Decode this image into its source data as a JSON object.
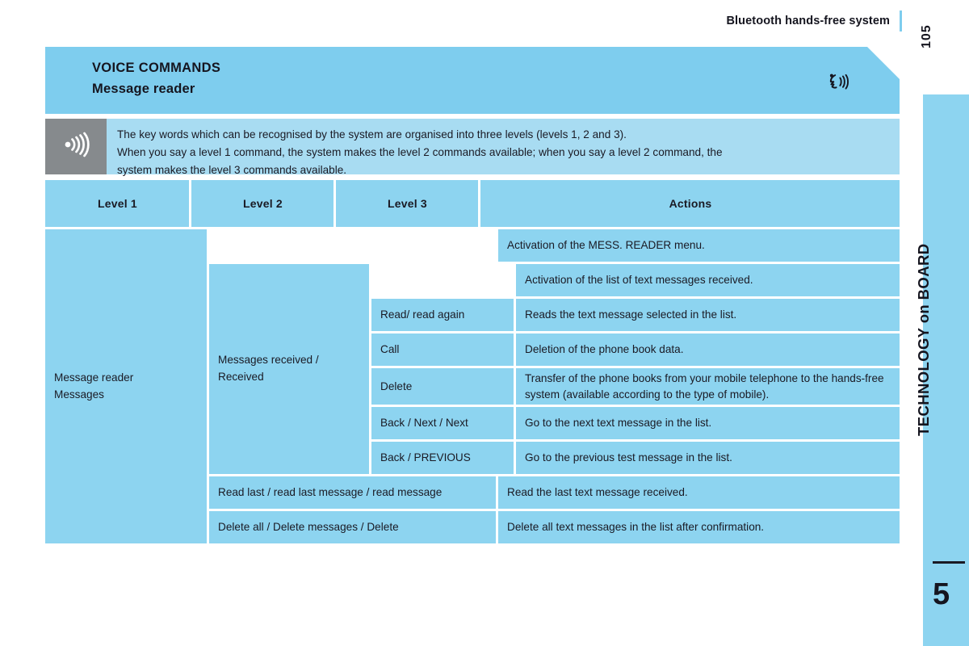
{
  "document": {
    "running_head": "Bluetooth hands-free system",
    "page_number": "105",
    "accent_color": "#7ecdee",
    "table_cell_color": "#8dd4f0",
    "note_background_color": "#a8dcf2",
    "note_icon_background_color": "#868a8d"
  },
  "banner": {
    "title": "VOICE COMMANDS",
    "subtitle": "Message reader",
    "icon": "speaking-head-icon"
  },
  "note": {
    "icon": "sound-waves-icon",
    "lines": [
      "The key words which can be recognised by the system are organised into three levels (levels 1, 2 and 3).",
      "When you say a level 1 command, the system makes the level 2 commands available; when you say a level 2 command, the",
      "system makes the level 3 commands available."
    ]
  },
  "table": {
    "headers": {
      "level1": "Level 1",
      "level2": "Level 2",
      "level3": "Level 3",
      "actions": "Actions"
    },
    "level1": "Message reader\nMessages",
    "rows": {
      "top_action": "Activation of the MESS. READER menu.",
      "group": {
        "level2": "Messages received /\nReceived",
        "group_action": "Activation of the list of text messages received.",
        "items": [
          {
            "level3": "Read/ read again",
            "action": "Reads the text message selected in the list."
          },
          {
            "level3": "Call",
            "action": "Deletion of the phone book data."
          },
          {
            "level3": "Delete",
            "action": "Transfer of the phone books from your mobile telephone to the hands-free system (available according to the type of mobile)."
          },
          {
            "level3": "Back / Next / Next",
            "action": "Go to the next text message in the list."
          },
          {
            "level3": "Back / PREVIOUS",
            "action": "Go to the previous test message in the list."
          }
        ]
      },
      "wide_rows": [
        {
          "label": "Read last / read last message / read message",
          "action": "Read the last text message received."
        },
        {
          "label": "Delete all / Delete messages / Delete",
          "action": "Delete all text messages in the list after confirmation."
        }
      ]
    }
  },
  "side_tab": {
    "label": "TECHNOLOGY on BOARD",
    "chapter_number": "5"
  }
}
